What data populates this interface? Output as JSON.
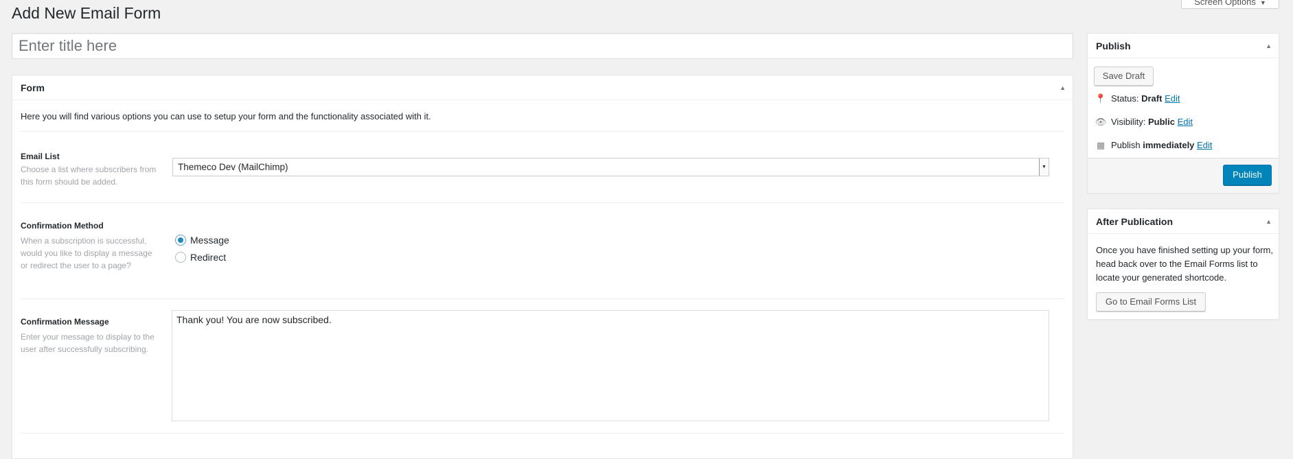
{
  "header": {
    "title": "Add New Email Form",
    "screen_options": "Screen Options"
  },
  "title_field": {
    "placeholder": "Enter title here",
    "value": ""
  },
  "form_box": {
    "heading": "Form",
    "intro": "Here you will find various options you can use to setup your form and the functionality associated with it.",
    "email_list": {
      "label": "Email List",
      "description": "Choose a list where subscribers from this form should be added.",
      "selected": "Themeco Dev (MailChimp)"
    },
    "confirmation_method": {
      "label": "Confirmation Method",
      "description": "When a subscription is successful, would you like to display a message or redirect the user to a page?",
      "options": [
        {
          "label": "Message",
          "checked": true
        },
        {
          "label": "Redirect",
          "checked": false
        }
      ]
    },
    "confirmation_message": {
      "label": "Confirmation Message",
      "description": "Enter your message to display to the user after successfully subscribing.",
      "value": "Thank you! You are now subscribed."
    }
  },
  "publish_box": {
    "heading": "Publish",
    "save_draft": "Save Draft",
    "status": {
      "label": "Status:",
      "value": "Draft",
      "edit": "Edit"
    },
    "visibility": {
      "label": "Visibility:",
      "value": "Public",
      "edit": "Edit"
    },
    "schedule": {
      "label": "Publish",
      "value": "immediately",
      "edit": "Edit"
    },
    "publish_button": "Publish"
  },
  "after_box": {
    "heading": "After Publication",
    "text": "Once you have finished setting up your form, head back over to the Email Forms list to locate your generated shortcode.",
    "button": "Go to Email Forms List"
  },
  "icons": {
    "toggle": "triangle-up-icon",
    "status": "pin-icon",
    "visibility": "eye-icon",
    "schedule": "calendar-icon",
    "select": "chevron-down-icon"
  },
  "colors": {
    "primary": "#0085ba",
    "link": "#0073aa",
    "background": "#f1f1f1"
  }
}
